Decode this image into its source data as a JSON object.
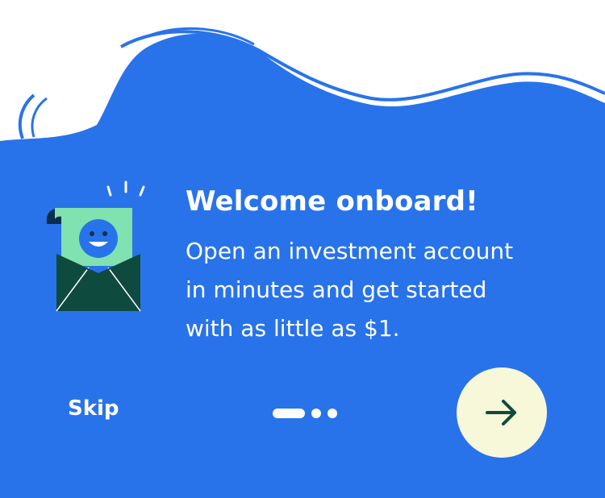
{
  "colors": {
    "background": "#2873ea",
    "accent_green": "#7fe2b0",
    "envelope_dark": "#0f4a3f",
    "next_button": "#f7f7d9",
    "arrow": "#0f4a3f"
  },
  "onboarding": {
    "title": "Welcome onboard!",
    "body_line1": "Open an investment account",
    "body_line2": "in minutes and get started",
    "body_line3": "with as little as $1.",
    "illustration_icon": "envelope-smiley-icon"
  },
  "footer": {
    "skip_label": "Skip",
    "pagination": {
      "current_page": 1,
      "total_pages": 3
    },
    "next_icon": "arrow-right-icon"
  }
}
